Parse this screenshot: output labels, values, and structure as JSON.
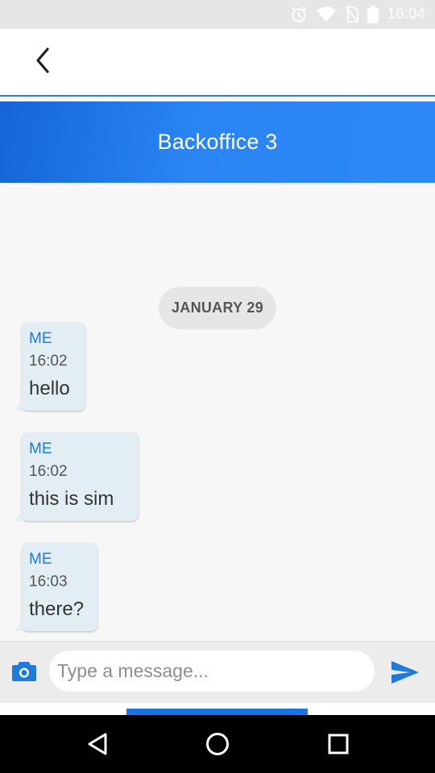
{
  "status_bar": {
    "time": "16:04"
  },
  "header": {
    "title": "Backoffice 3"
  },
  "conversation": {
    "date_label": "JANUARY 29",
    "messages": [
      {
        "sender": "ME",
        "time": "16:02",
        "text": "hello"
      },
      {
        "sender": "ME",
        "time": "16:02",
        "text": "this is sim"
      },
      {
        "sender": "ME",
        "time": "16:03",
        "text": "there?"
      }
    ]
  },
  "composer": {
    "placeholder": "Type a message..."
  },
  "colors": {
    "accent": "#2b7dd8",
    "header_gradient_start": "#1565d8",
    "header_gradient_end": "#2e88f8",
    "bubble": "#e3edf4",
    "sender_text": "#1f7ad8",
    "send_icon": "#1f7ad8"
  },
  "icons": {
    "status": [
      "alarm-icon",
      "wifi-icon",
      "no-sim-icon",
      "battery-icon"
    ],
    "app_bar": [
      "back-arrow-icon"
    ],
    "composer": [
      "camera-icon",
      "send-icon"
    ],
    "nav": [
      "nav-back-icon",
      "nav-home-icon",
      "nav-recents-icon"
    ]
  }
}
